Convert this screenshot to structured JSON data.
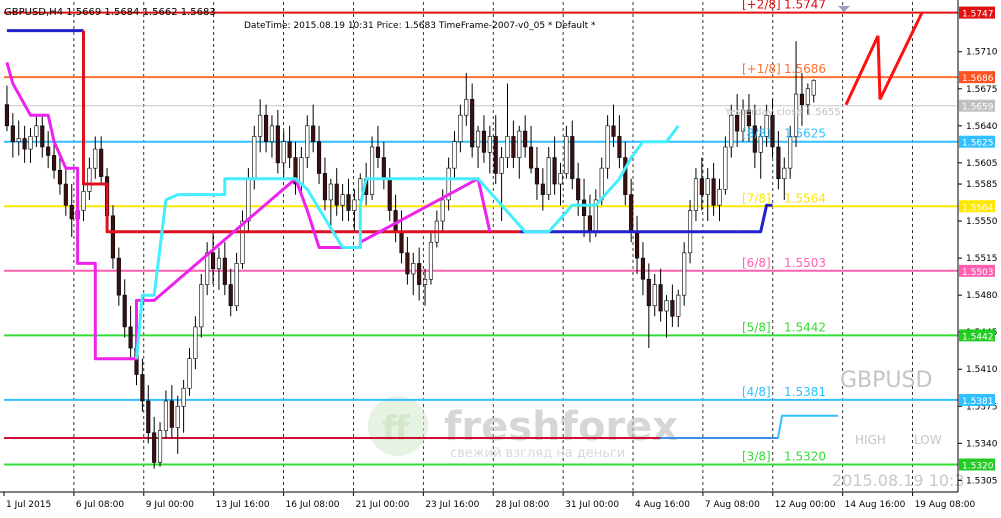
{
  "header": {
    "symbol_info": "GBPUSD,H4  1.5669 1.5684 1.5662 1.5683",
    "info_line": "DateTime: 2015.08.19 10:31   Price: 1.5683   TimeFrame-2007-v0_05   *   Default   *"
  },
  "watermark": {
    "symbol": "GBPUSD",
    "brand": "freshforex",
    "slogan": "свежий взгляд на деньги",
    "high_label": "HIGH",
    "low_label": "LOW",
    "date": "2015.08.19 10:3"
  },
  "chart_data": {
    "type": "candlestick",
    "symbol": "GBPUSD",
    "timeframe": "H4",
    "ylim": [
      1.5294,
      1.5757
    ],
    "y_ticks": [
      "1.5710",
      "1.5675",
      "1.5640",
      "1.5605",
      "1.5585",
      "1.5550",
      "1.5515",
      "1.5480",
      "1.5445",
      "1.5410",
      "1.5375",
      "1.5340",
      "1.5305"
    ],
    "x_ticks": [
      "1 Jul 2015",
      "6 Jul 08:00",
      "9 Jul 00:00",
      "13 Jul 16:00",
      "16 Jul 08:00",
      "21 Jul 00:00",
      "23 Jul 16:00",
      "28 Jul 08:00",
      "31 Jul 00:00",
      "4 Aug 16:00",
      "7 Aug 08:00",
      "12 Aug 00:00",
      "14 Aug 16:00",
      "19 Aug 08:00"
    ],
    "grid": true,
    "murrey_levels": [
      {
        "label": "[+2/8]",
        "value": "1.5747",
        "color": "#e01010"
      },
      {
        "label": "[+1/8]",
        "value": "1.5686",
        "color": "#ff7030"
      },
      {
        "label": "[8/8]",
        "value": "1.5625",
        "color": "#30c0ff"
      },
      {
        "label": "[7/8]",
        "value": "1.5564",
        "color": "#ffe800"
      },
      {
        "label": "[6/8]",
        "value": "1.5503",
        "color": "#ff60b0"
      },
      {
        "label": "[5/8]",
        "value": "1.5442",
        "color": "#33dd33"
      },
      {
        "label": "[4/8]",
        "value": "1.5381",
        "color": "#30c0ff"
      },
      {
        "label": "[3/8]",
        "value": "1.5320",
        "color": "#33dd33"
      }
    ],
    "price_tags": [
      {
        "value": "1.5747",
        "color": "#e01010"
      },
      {
        "value": "1.5686",
        "color": "#ff5020"
      },
      {
        "value": "1.5659",
        "color": "#c0c0c0"
      },
      {
        "value": "1.5625",
        "color": "#30c0ff"
      },
      {
        "value": "1.5564",
        "color": "#ffe800"
      },
      {
        "value": "1.5503",
        "color": "#ff60b0"
      },
      {
        "value": "1.5442",
        "color": "#22cc22"
      },
      {
        "value": "1.5381",
        "color": "#30c0ff"
      },
      {
        "value": "1.5320",
        "color": "#22cc22"
      }
    ],
    "yesterday_label": "Yesterday close 1.5655",
    "candles": [
      [
        1.566,
        1.5678,
        1.5635,
        1.564
      ],
      [
        1.564,
        1.5652,
        1.561,
        1.5625
      ],
      [
        1.5625,
        1.5645,
        1.5612,
        1.5628
      ],
      [
        1.5628,
        1.564,
        1.5605,
        1.5618
      ],
      [
        1.5618,
        1.5638,
        1.5605,
        1.563
      ],
      [
        1.563,
        1.565,
        1.562,
        1.564
      ],
      [
        1.564,
        1.565,
        1.561,
        1.562
      ],
      [
        1.562,
        1.5635,
        1.56,
        1.5612
      ],
      [
        1.5612,
        1.5628,
        1.559,
        1.5598
      ],
      [
        1.5598,
        1.5615,
        1.5575,
        1.5585
      ],
      [
        1.5585,
        1.56,
        1.5555,
        1.5565
      ],
      [
        1.5565,
        1.5585,
        1.5535,
        1.5552
      ],
      [
        1.5552,
        1.557,
        1.5525,
        1.556
      ],
      [
        1.556,
        1.5585,
        1.555,
        1.5578
      ],
      [
        1.5578,
        1.561,
        1.557,
        1.56
      ],
      [
        1.56,
        1.563,
        1.559,
        1.5618
      ],
      [
        1.5618,
        1.563,
        1.5585,
        1.5592
      ],
      [
        1.5592,
        1.56,
        1.5545,
        1.5555
      ],
      [
        1.5555,
        1.5565,
        1.5505,
        1.5515
      ],
      [
        1.5515,
        1.5525,
        1.547,
        1.548
      ],
      [
        1.548,
        1.5495,
        1.544,
        1.545
      ],
      [
        1.545,
        1.547,
        1.542,
        1.543
      ],
      [
        1.543,
        1.5445,
        1.5395,
        1.5405
      ],
      [
        1.5405,
        1.542,
        1.537,
        1.538
      ],
      [
        1.538,
        1.5395,
        1.534,
        1.535
      ],
      [
        1.535,
        1.5365,
        1.5316,
        1.5322
      ],
      [
        1.5322,
        1.536,
        1.5318,
        1.5352
      ],
      [
        1.5352,
        1.539,
        1.5345,
        1.538
      ],
      [
        1.538,
        1.5395,
        1.5345,
        1.5355
      ],
      [
        1.5355,
        1.5385,
        1.533,
        1.5375
      ],
      [
        1.5375,
        1.54,
        1.535,
        1.5392
      ],
      [
        1.5392,
        1.543,
        1.5385,
        1.542
      ],
      [
        1.542,
        1.546,
        1.541,
        1.545
      ],
      [
        1.545,
        1.55,
        1.544,
        1.549
      ],
      [
        1.549,
        1.553,
        1.548,
        1.552
      ],
      [
        1.552,
        1.554,
        1.549,
        1.5505
      ],
      [
        1.5505,
        1.5525,
        1.5485,
        1.5515
      ],
      [
        1.5515,
        1.553,
        1.548,
        1.549
      ],
      [
        1.549,
        1.5505,
        1.546,
        1.547
      ],
      [
        1.547,
        1.552,
        1.5465,
        1.551
      ],
      [
        1.551,
        1.556,
        1.5505,
        1.555
      ],
      [
        1.555,
        1.56,
        1.554,
        1.559
      ],
      [
        1.559,
        1.564,
        1.558,
        1.563
      ],
      [
        1.563,
        1.5665,
        1.5615,
        1.565
      ],
      [
        1.565,
        1.566,
        1.5615,
        1.5625
      ],
      [
        1.5625,
        1.565,
        1.561,
        1.564
      ],
      [
        1.564,
        1.5655,
        1.5595,
        1.5605
      ],
      [
        1.5605,
        1.5635,
        1.559,
        1.5625
      ],
      [
        1.5625,
        1.564,
        1.56,
        1.561
      ],
      [
        1.561,
        1.5625,
        1.5575,
        1.5585
      ],
      [
        1.5585,
        1.562,
        1.5575,
        1.561
      ],
      [
        1.561,
        1.565,
        1.56,
        1.564
      ],
      [
        1.564,
        1.566,
        1.5615,
        1.5625
      ],
      [
        1.5625,
        1.564,
        1.5585,
        1.5595
      ],
      [
        1.5595,
        1.561,
        1.556,
        1.557
      ],
      [
        1.557,
        1.559,
        1.5545,
        1.5585
      ],
      [
        1.5585,
        1.56,
        1.5555,
        1.5565
      ],
      [
        1.5565,
        1.5585,
        1.555,
        1.5575
      ],
      [
        1.5575,
        1.559,
        1.555,
        1.556
      ],
      [
        1.556,
        1.558,
        1.554,
        1.557
      ],
      [
        1.557,
        1.5595,
        1.556,
        1.559
      ],
      [
        1.559,
        1.5605,
        1.5565,
        1.5575
      ],
      [
        1.5575,
        1.563,
        1.557,
        1.562
      ],
      [
        1.562,
        1.564,
        1.56,
        1.561
      ],
      [
        1.561,
        1.5625,
        1.558,
        1.559
      ],
      [
        1.559,
        1.56,
        1.555,
        1.556
      ],
      [
        1.556,
        1.5575,
        1.553,
        1.554
      ],
      [
        1.554,
        1.556,
        1.551,
        1.552
      ],
      [
        1.552,
        1.5535,
        1.549,
        1.55
      ],
      [
        1.55,
        1.552,
        1.548,
        1.551
      ],
      [
        1.551,
        1.5525,
        1.5475,
        1.549
      ],
      [
        1.549,
        1.5505,
        1.547,
        1.5495
      ],
      [
        1.5495,
        1.554,
        1.549,
        1.553
      ],
      [
        1.553,
        1.556,
        1.5525,
        1.555
      ],
      [
        1.555,
        1.558,
        1.554,
        1.557
      ],
      [
        1.557,
        1.561,
        1.556,
        1.56
      ],
      [
        1.56,
        1.5635,
        1.559,
        1.5625
      ],
      [
        1.5625,
        1.566,
        1.5615,
        1.565
      ],
      [
        1.565,
        1.569,
        1.564,
        1.5665
      ],
      [
        1.5665,
        1.568,
        1.561,
        1.562
      ],
      [
        1.562,
        1.564,
        1.56,
        1.5635
      ],
      [
        1.5635,
        1.565,
        1.5605,
        1.5615
      ],
      [
        1.5615,
        1.564,
        1.5595,
        1.563
      ],
      [
        1.563,
        1.565,
        1.5585,
        1.5595
      ],
      [
        1.5595,
        1.562,
        1.555,
        1.561
      ],
      [
        1.561,
        1.568,
        1.56,
        1.563
      ],
      [
        1.563,
        1.5645,
        1.56,
        1.561
      ],
      [
        1.561,
        1.564,
        1.559,
        1.5635
      ],
      [
        1.5635,
        1.565,
        1.561,
        1.562
      ],
      [
        1.562,
        1.564,
        1.5595,
        1.56
      ],
      [
        1.56,
        1.562,
        1.557,
        1.5585
      ],
      [
        1.5585,
        1.56,
        1.556,
        1.5575
      ],
      [
        1.5575,
        1.562,
        1.557,
        1.561
      ],
      [
        1.561,
        1.563,
        1.5575,
        1.5585
      ],
      [
        1.5585,
        1.5605,
        1.5565,
        1.5595
      ],
      [
        1.5595,
        1.564,
        1.559,
        1.563
      ],
      [
        1.563,
        1.5645,
        1.558,
        1.559
      ],
      [
        1.559,
        1.5605,
        1.5555,
        1.557
      ],
      [
        1.557,
        1.559,
        1.5535,
        1.5555
      ],
      [
        1.5555,
        1.5575,
        1.553,
        1.554
      ],
      [
        1.554,
        1.558,
        1.5535,
        1.557
      ],
      [
        1.557,
        1.561,
        1.5565,
        1.56
      ],
      [
        1.56,
        1.565,
        1.559,
        1.564
      ],
      [
        1.564,
        1.566,
        1.562,
        1.563
      ],
      [
        1.563,
        1.565,
        1.56,
        1.561
      ],
      [
        1.561,
        1.5625,
        1.5565,
        1.5575
      ],
      [
        1.5575,
        1.559,
        1.553,
        1.554
      ],
      [
        1.554,
        1.5555,
        1.55,
        1.5515
      ],
      [
        1.5515,
        1.553,
        1.548,
        1.5495
      ],
      [
        1.5495,
        1.551,
        1.543,
        1.547
      ],
      [
        1.547,
        1.55,
        1.546,
        1.549
      ],
      [
        1.549,
        1.5505,
        1.5455,
        1.5465
      ],
      [
        1.5465,
        1.548,
        1.544,
        1.5475
      ],
      [
        1.5475,
        1.549,
        1.545,
        1.546
      ],
      [
        1.546,
        1.5485,
        1.545,
        1.548
      ],
      [
        1.548,
        1.553,
        1.547,
        1.552
      ],
      [
        1.552,
        1.557,
        1.551,
        1.556
      ],
      [
        1.556,
        1.56,
        1.555,
        1.559
      ],
      [
        1.559,
        1.561,
        1.556,
        1.5575
      ],
      [
        1.5575,
        1.56,
        1.555,
        1.559
      ],
      [
        1.559,
        1.5605,
        1.5555,
        1.5565
      ],
      [
        1.5565,
        1.559,
        1.555,
        1.558
      ],
      [
        1.558,
        1.563,
        1.5575,
        1.562
      ],
      [
        1.562,
        1.566,
        1.561,
        1.565
      ],
      [
        1.565,
        1.567,
        1.562,
        1.5635
      ],
      [
        1.5635,
        1.5665,
        1.5625,
        1.5655
      ],
      [
        1.5655,
        1.567,
        1.5625,
        1.564
      ],
      [
        1.564,
        1.566,
        1.56,
        1.5615
      ],
      [
        1.5615,
        1.564,
        1.559,
        1.563
      ],
      [
        1.563,
        1.566,
        1.562,
        1.565
      ],
      [
        1.565,
        1.5665,
        1.561,
        1.562
      ],
      [
        1.562,
        1.5635,
        1.558,
        1.559
      ],
      [
        1.559,
        1.561,
        1.557,
        1.56
      ],
      [
        1.56,
        1.564,
        1.559,
        1.563
      ],
      [
        1.563,
        1.572,
        1.562,
        1.567
      ],
      [
        1.567,
        1.569,
        1.564,
        1.566
      ],
      [
        1.566,
        1.568,
        1.565,
        1.5675
      ],
      [
        1.5669,
        1.5684,
        1.5662,
        1.5683
      ]
    ],
    "murrey_stops": {
      "red_blue": [
        [
          0,
          1.573
        ],
        [
          13,
          1.573
        ],
        [
          13,
          1.5585
        ],
        [
          17,
          1.5585
        ],
        [
          17,
          1.554
        ],
        [
          87,
          1.554
        ],
        [
          87,
          1.554
        ],
        [
          124,
          1.554
        ],
        [
          128,
          1.554
        ],
        [
          129,
          1.5565
        ],
        [
          130,
          1.5565
        ]
      ],
      "magenta": [
        [
          0,
          1.57
        ],
        [
          1,
          1.568
        ],
        [
          4,
          1.565
        ],
        [
          7,
          1.565
        ],
        [
          8,
          1.5625
        ],
        [
          10,
          1.56
        ],
        [
          12,
          1.56
        ],
        [
          12,
          1.551
        ],
        [
          15,
          1.551
        ],
        [
          15,
          1.542
        ],
        [
          22,
          1.542
        ],
        [
          22,
          1.5475
        ],
        [
          23,
          1.5475
        ],
        [
          25,
          1.5475
        ],
        [
          49,
          1.559
        ],
        [
          51,
          1.556
        ],
        [
          53,
          1.5525
        ],
        [
          60,
          1.5525
        ],
        [
          60,
          1.553
        ],
        [
          80,
          1.559
        ],
        [
          82,
          1.554
        ]
      ],
      "cyan": [
        [
          22,
          1.542
        ],
        [
          23,
          1.548
        ],
        [
          25,
          1.548
        ],
        [
          27,
          1.557
        ],
        [
          29,
          1.5575
        ],
        [
          37,
          1.5575
        ],
        [
          37,
          1.559
        ],
        [
          49,
          1.559
        ],
        [
          49,
          1.559
        ],
        [
          51,
          1.558
        ],
        [
          57,
          1.5525
        ],
        [
          60,
          1.5525
        ],
        [
          60,
          1.5565
        ],
        [
          61,
          1.559
        ],
        [
          80,
          1.559
        ],
        [
          88,
          1.554
        ],
        [
          92,
          1.554
        ],
        [
          96,
          1.5565
        ],
        [
          100,
          1.5565
        ],
        [
          104,
          1.559
        ],
        [
          106,
          1.561
        ],
        [
          108,
          1.5625
        ],
        [
          110,
          1.5625
        ],
        [
          112,
          1.5625
        ],
        [
          114,
          1.564
        ]
      ]
    },
    "projection": [
      [
        1.566
      ],
      [
        1.5725
      ],
      [
        1.5665
      ],
      [
        1.5747
      ]
    ]
  }
}
